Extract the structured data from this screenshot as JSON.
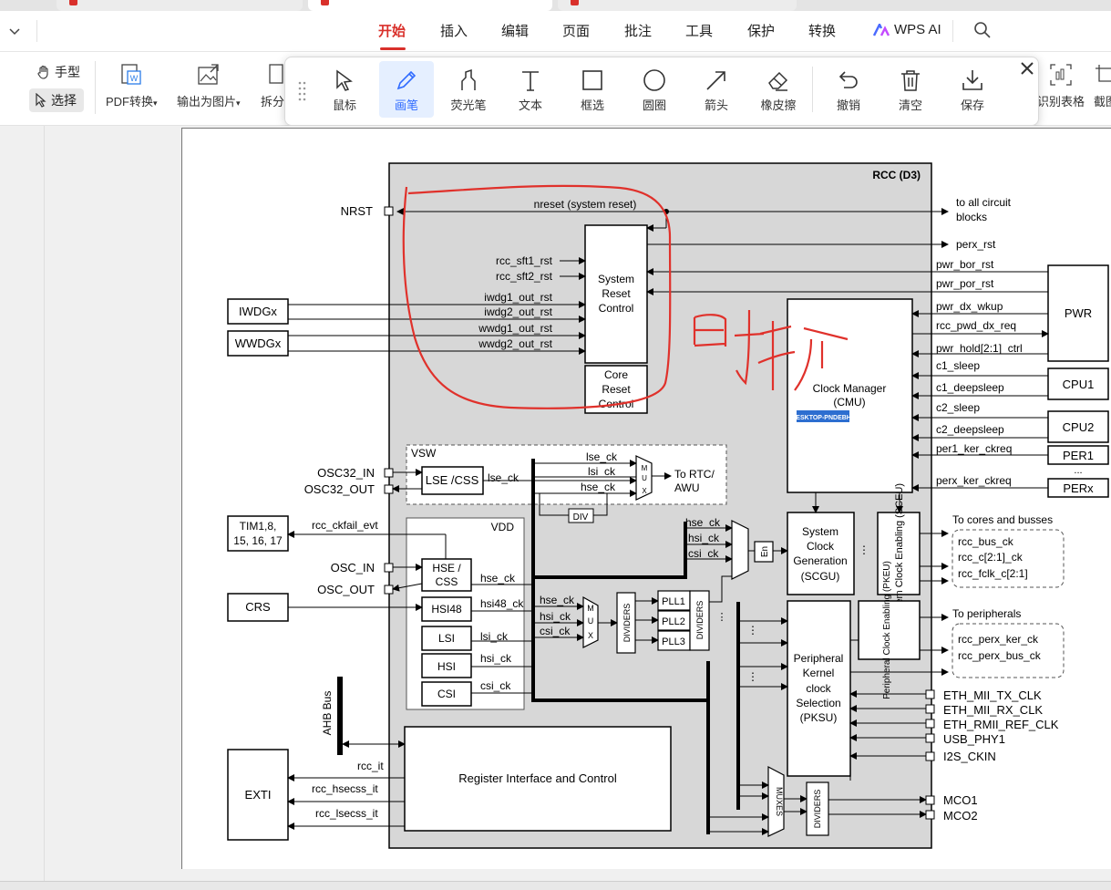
{
  "menu": {
    "items": [
      "开始",
      "插入",
      "编辑",
      "页面",
      "批注",
      "工具",
      "保护",
      "转换"
    ],
    "active": "开始",
    "wps_ai": "WPS AI"
  },
  "toolbar": {
    "hand": "手型",
    "select": "选择",
    "pdf_convert": "PDF转换",
    "export_image": "输出为图片",
    "split": "拆分",
    "table_recognize": "识别表格",
    "screenshot": "截图"
  },
  "annot_tools": {
    "mouse": "鼠标",
    "pen": "画笔",
    "highlighter": "荧光笔",
    "text": "文本",
    "rect": "框选",
    "circle": "圆圈",
    "arrow": "箭头",
    "eraser": "橡皮擦",
    "undo": "撤销",
    "clear": "清空",
    "save": "保存"
  },
  "diagram": {
    "title": "RCC (D3)",
    "nrst": "NRST",
    "nreset": "nreset (system reset)",
    "to_all": "to all circuit",
    "blocks": "blocks",
    "perx_rst": "perx_rst",
    "pwr_bor_rst": "pwr_bor_rst",
    "pwr_por_rst": "pwr_por_rst",
    "pwr_dx_wkup": "pwr_dx_wkup",
    "rcc_pwd_dx_req": "rcc_pwd_dx_req",
    "pwr_hold": "pwr_hold[2:1]_ctrl",
    "c1_sleep": "c1_sleep",
    "c1_deepsleep": "c1_deepsleep",
    "c2_sleep": "c2_sleep",
    "c2_deepsleep": "c2_deepsleep",
    "per1_ker_ckreq": "per1_ker_ckreq",
    "perx_ker_ckreq": "perx_ker_ckreq",
    "pwr": "PWR",
    "cpu1": "CPU1",
    "cpu2": "CPU2",
    "per1": "PER1",
    "perx": "PERx",
    "dots": "...",
    "rcc_sft1": "rcc_sft1_rst",
    "rcc_sft2": "rcc_sft2_rst",
    "iwdg1": "iwdg1_out_rst",
    "iwdg2": "iwdg2_out_rst",
    "wwdg1": "wwdg1_out_rst",
    "wwdg2": "wwdg2_out_rst",
    "iwdgx": "IWDGx",
    "wwdgx": "WWDGx",
    "sys_reset_1": "System",
    "sys_reset_2": "Reset",
    "sys_reset_3": "Control",
    "core_reset_1": "Core",
    "core_reset_2": "Reset",
    "core_reset_3": "Control",
    "cmu_1": "Clock Manager",
    "cmu_2": "(CMU)",
    "desktop_tag": "DESKTOP-PNDEBH6",
    "handwriting": "时钟",
    "vsw": "VSW",
    "osc32_in": "OSC32_IN",
    "osc32_out": "OSC32_OUT",
    "lse_css": "LSE /CSS",
    "lse_ck": "lse_ck",
    "lsi_ck": "lsi_ck",
    "hse_ck": "hse_ck",
    "hsi_ck": "hsi_ck",
    "csi_ck": "csi_ck",
    "hsi48_ck": "hsi48_ck",
    "mux": "MUX",
    "to_rtc_1": "To RTC/",
    "to_rtc_2": "AWU",
    "div": "DIV",
    "vdd": "VDD",
    "tim": "TIM1,8,",
    "tim2": "15, 16, 17",
    "rcc_ckfail": "rcc_ckfail_evt",
    "osc_in": "OSC_IN",
    "osc_out": "OSC_OUT",
    "hse_css_1": "HSE /",
    "hse_css_2": "CSS",
    "crs": "CRS",
    "hsi48": "HSI48",
    "lsi": "LSI",
    "hsi": "HSI",
    "csi": "CSI",
    "dividers": "DIVIDERS",
    "pll1": "PLL1",
    "pll2": "PLL2",
    "pll3": "PLL3",
    "en": "En",
    "scgu_1": "System",
    "scgu_2": "Clock",
    "scgu_3": "Generation",
    "scgu_4": "(SCGU)",
    "sceu": "System Clock Enabling (SCEU)",
    "to_cores": "To cores and busses",
    "rcc_bus_ck": "rcc_bus_ck",
    "rcc_c_ck": "rcc_c[2:1]_ck",
    "rcc_fclk": "rcc_fclk_c[2:1]",
    "to_periph": "To peripherals",
    "rcc_perx_ker": "rcc_perx_ker_ck",
    "rcc_perx_bus": "rcc_perx_bus_ck",
    "pksu_1": "Peripheral",
    "pksu_2": "Kernel",
    "pksu_3": "clock",
    "pksu_4": "Selection",
    "pksu_5": "(PKSU)",
    "pkeu": "Peripheral Clock Enabling (PKEU)",
    "eth_tx": "ETH_MII_TX_CLK",
    "eth_rx": "ETH_MII_RX_CLK",
    "eth_rmii": "ETH_RMII_REF_CLK",
    "usb_phy": "USB_PHY1",
    "i2s": "I2S_CKIN",
    "ahb": "AHB Bus",
    "exti": "EXTI",
    "rcc_it": "rcc_it",
    "rcc_hsecss": "rcc_hsecss_it",
    "rcc_lsecss": "rcc_lsecss_it",
    "reg_iface": "Register Interface and Control",
    "muxes": "MUXES",
    "mco1": "MCO1",
    "mco2": "MCO2"
  }
}
